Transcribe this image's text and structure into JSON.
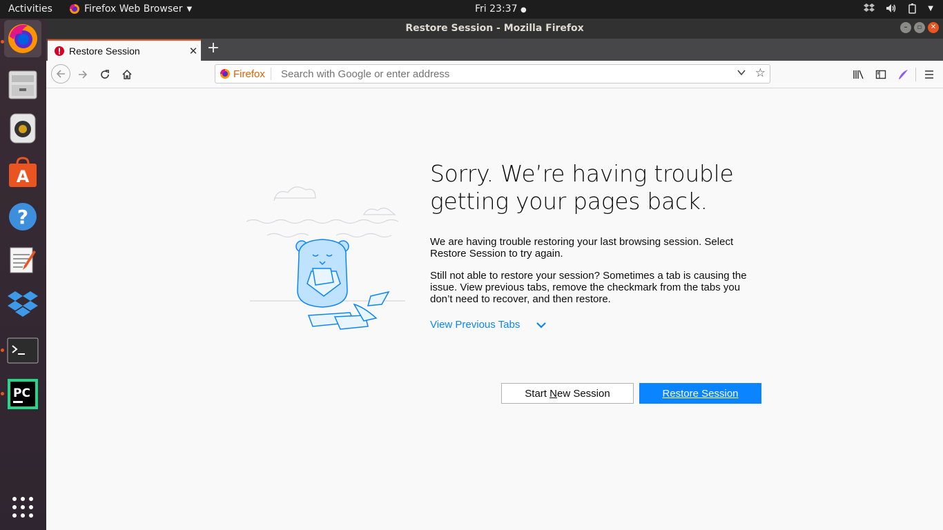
{
  "topbar": {
    "activities": "Activities",
    "app_menu": "Firefox Web Browser",
    "clock": "Fri 23:37"
  },
  "window": {
    "title": "Restore Session - Mozilla Firefox"
  },
  "tab": {
    "label": "Restore Session"
  },
  "urlbar": {
    "identity_label": "Firefox",
    "placeholder": "Search with Google or enter address"
  },
  "page": {
    "heading_line1": "Sorry. We’re having trouble",
    "heading_line2": "getting your pages back.",
    "para1_line1": "We are having trouble restoring your last browsing session. Select",
    "para1_line2": "Restore Session to try again.",
    "para2_line1": "Still not able to restore your session? Sometimes a tab is causing the",
    "para2_line2": "issue. View previous tabs, remove the checkmark from the tabs you",
    "para2_line3": "don’t need to recover, and then restore.",
    "view_previous_tabs": "View Previous Tabs",
    "start_new_pre": "Start ",
    "start_new_ul": "N",
    "start_new_post": "ew Session",
    "restore_ul": "R",
    "restore_post": "estore Session"
  },
  "dock": {
    "items": [
      "firefox-icon",
      "files-icon",
      "rhythmbox-icon",
      "software-icon",
      "help-icon",
      "text-editor-icon",
      "dropbox-icon",
      "terminal-icon",
      "pycharm-icon",
      "show-apps-icon"
    ]
  },
  "colors": {
    "accent": "#0a84ff",
    "ubuntu_orange": "#e95420",
    "topbar": "#1d1d1d"
  }
}
